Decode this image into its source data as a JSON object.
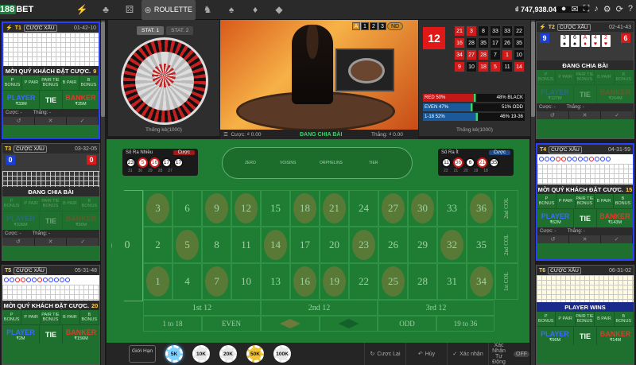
{
  "brand": {
    "logo_num": "188",
    "logo_text": "BET"
  },
  "nav": {
    "active_label": "ROULETTE"
  },
  "account": {
    "balance": "₫ 747,938.04"
  },
  "left_tables": [
    {
      "id": "T1",
      "tag": "CƯỢC XẤU",
      "code": "01-42-10",
      "banner": "MỜI QUÝ KHÁCH ĐẶT CƯỢC.",
      "count": "9",
      "p_bonus": "P BONUS",
      "p_pair": "P PAIR",
      "pair_tie": "PAIR TIE BONUS",
      "b_pair": "B PAIR",
      "b_bonus": "B BONUS",
      "player": "PLAYER",
      "player_amt": "₹33M",
      "tie": "TIE",
      "banker": "BANKER",
      "banker_amt": "₹35M",
      "bet_label": "Cược:",
      "win_label": "Thắng:",
      "bet_val": "-",
      "win_val": "-"
    },
    {
      "id": "T3",
      "tag": "CƯỢC XẤU",
      "code": "03-32-05",
      "banner": "ĐANG CHIA BÀI",
      "score_p": "0",
      "score_b": "0",
      "p_bonus": "P BONUS",
      "p_pair": "P PAIR",
      "pair_tie": "PAIR TIE BONUS",
      "b_pair": "B PAIR",
      "b_bonus": "B BONUS",
      "player": "PLAYER",
      "player_amt": "₹336M",
      "tie": "TIE",
      "banker": "BANKER",
      "banker_amt": "₹96M",
      "bet_label": "Cược:",
      "win_label": "Thắng:",
      "bet_val": "-",
      "win_val": "-"
    },
    {
      "id": "T5",
      "tag": "CƯỢC XẤU",
      "code": "05-31-48",
      "banner": "MỜI QUÝ KHÁCH ĐẶT CƯỢC.",
      "count": "20",
      "p_bonus": "P BONUS",
      "p_pair": "P PAIR",
      "pair_tie": "PAIR TIE BONUS",
      "b_pair": "B PAIR",
      "b_bonus": "B BONUS",
      "player": "PLAYER",
      "player_amt": "₹2M",
      "tie": "TIE",
      "banker": "BANKER",
      "banker_amt": "₹156M"
    }
  ],
  "right_tables": [
    {
      "id": "T2",
      "tag": "CƯỢC XẤU",
      "code": "02-41-43",
      "score_p": "9",
      "score_b": "6",
      "banner": "ĐANG CHIA BÀI",
      "p_bonus": "P BONUS",
      "p_pair": "P PAIR",
      "pair_tie": "PAIR TIE BONUS",
      "b_pair": "B PAIR",
      "b_bonus": "B BONUS",
      "player": "PLAYER",
      "player_amt": "₹127M",
      "tie": "TIE",
      "banker": "BANKER",
      "banker_amt": "₹264M",
      "bet_label": "Cược:",
      "win_label": "Thắng:",
      "bet_val": "-",
      "win_val": "-"
    },
    {
      "id": "T4",
      "tag": "CƯỢC XẤU",
      "code": "04-31-59",
      "banner": "MỜI QUÝ KHÁCH ĐẶT CƯỢC.",
      "count": "15",
      "p_bonus": "P BONUS",
      "p_pair": "P PAIR",
      "pair_tie": "PAIR TIE BONUS",
      "b_pair": "B PAIR",
      "b_bonus": "B BONUS",
      "player": "PLAYER",
      "player_amt": "₹62M",
      "tie": "TIE",
      "banker": "BANKER",
      "banker_amt": "₹143M",
      "bet_label": "Cược:",
      "win_label": "Thắng:",
      "bet_val": "-",
      "win_val": "-"
    },
    {
      "id": "T6",
      "tag": "CƯỢC XẤU",
      "code": "06-31-02",
      "banner": "PLAYER WINS",
      "p_bonus": "P BONUS",
      "p_pair": "P PAIR",
      "pair_tie": "PAIR TIE BONUS",
      "b_pair": "B PAIR",
      "b_bonus": "B BONUS",
      "player": "PLAYER",
      "player_amt": "₹56M",
      "tie": "TIE",
      "banker": "BANKER",
      "banker_amt": "₹14M"
    }
  ],
  "stats": {
    "tab1": "STAT. 1",
    "tab2": "STAT. 2",
    "label": "Thống kê(1000)"
  },
  "video": {
    "roads": [
      "A",
      "1",
      "2",
      "3"
    ],
    "nd": "ND",
    "bet_label": "Cược:",
    "bet_val": "₫ 0.00",
    "status": "ĐANG CHIA BÀI",
    "win_label": "Thắng:",
    "win_val": "₫ 0.00"
  },
  "results": {
    "current": "12",
    "history": [
      "21",
      "3",
      "8",
      "33",
      "33",
      "22",
      "16",
      "28",
      "35",
      "17",
      "26",
      "35",
      "34",
      "27",
      "28",
      "7",
      "1",
      "10",
      "9",
      "10",
      "18",
      "5",
      "11",
      "14"
    ],
    "red_pct": "RED 50%",
    "black_pct": "48% BLACK",
    "even_pct": "EVEN 47%",
    "odd_pct": "51% ODD",
    "low_pct": "1-18 52%",
    "high_pct": "46% 19-36",
    "label": "Thống kê(1000)"
  },
  "hot": {
    "title": "Số Ra Nhiều",
    "tab": "Cược",
    "nums": [
      "23",
      "5",
      "16",
      "17",
      "17"
    ],
    "counts": [
      "31",
      "30",
      "29",
      "28",
      "27"
    ]
  },
  "cold": {
    "title": "Số Ra Ít",
    "tab": "Cược",
    "nums": [
      "11",
      "36",
      "6",
      "21",
      "35"
    ],
    "counts": [
      "22",
      "21",
      "20",
      "19",
      "18"
    ]
  },
  "track": {
    "a": "ZERO",
    "b": "VOISINS",
    "c": "ORPHELINS",
    "d": "TIER"
  },
  "board": {
    "zero": "0",
    "col1": "2nd COL",
    "col2": "2nd COL",
    "col3": "1st COL",
    "doz1": "1st 12",
    "doz2": "2nd 12",
    "doz3": "3rd 12",
    "low": "1 to 18",
    "even": "EVEN",
    "odd": "ODD",
    "high": "19 to 36"
  },
  "controls": {
    "limit": "Giới Hạn",
    "chips": [
      "5K",
      "10K",
      "20K",
      "50K",
      "100K"
    ],
    "rebet": "Cược Lại",
    "undo": "Hủy",
    "confirm": "Xác nhận",
    "auto": "Xác Nhận Tự Động",
    "off": "OFF"
  }
}
